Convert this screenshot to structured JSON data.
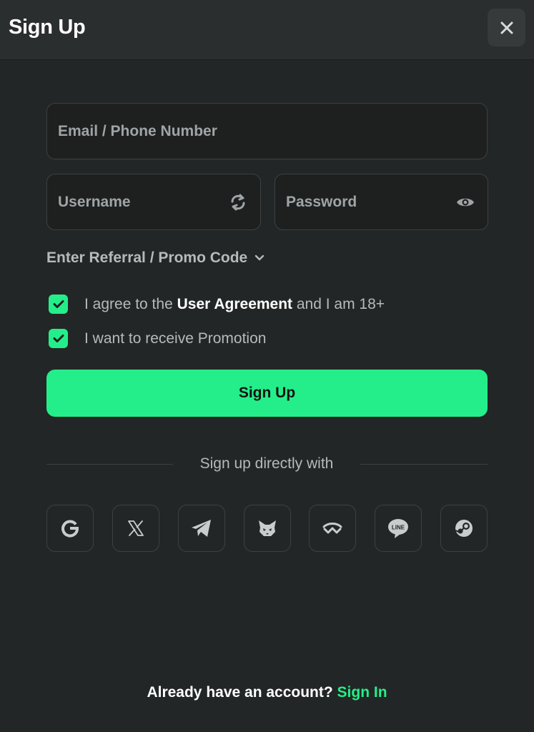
{
  "header": {
    "title": "Sign Up"
  },
  "form": {
    "email_placeholder": "Email / Phone Number",
    "username_placeholder": "Username",
    "password_placeholder": "Password",
    "referral_label": "Enter Referral / Promo Code",
    "agree_prefix": "I agree to the ",
    "agree_link": "User Agreement",
    "agree_suffix": " and I am 18+",
    "agree_checked": true,
    "promo_label": "I want to receive Promotion",
    "promo_checked": true,
    "submit_label": "Sign Up"
  },
  "social": {
    "heading": "Sign up directly with",
    "providers": [
      {
        "name": "google",
        "icon": "google-icon"
      },
      {
        "name": "x",
        "icon": "x-icon"
      },
      {
        "name": "telegram",
        "icon": "telegram-icon"
      },
      {
        "name": "metamask",
        "icon": "metamask-icon"
      },
      {
        "name": "walletconnect",
        "icon": "walletconnect-icon"
      },
      {
        "name": "line",
        "icon": "line-icon",
        "icon_text": "LINE"
      },
      {
        "name": "steam",
        "icon": "steam-icon"
      }
    ]
  },
  "footer": {
    "prompt": "Already have an account? ",
    "link": "Sign In"
  },
  "colors": {
    "accent": "#24ee89",
    "background": "#232626",
    "header_bg": "#2b2e2e",
    "input_bg": "#1e2020",
    "border": "#3d4141"
  }
}
